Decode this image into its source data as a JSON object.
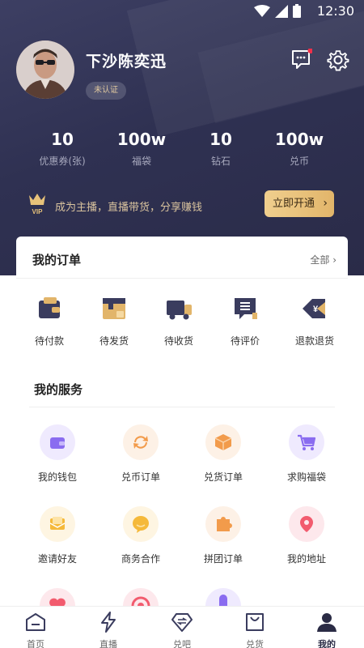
{
  "status_bar": {
    "time": "12:30"
  },
  "profile": {
    "name": "下沙陈奕迅",
    "badge": "未认证"
  },
  "stats": [
    {
      "value": "10",
      "label": "优惠券(张)"
    },
    {
      "value": "100w",
      "label": "福袋"
    },
    {
      "value": "10",
      "label": "钻石"
    },
    {
      "value": "100w",
      "label": "兑币"
    }
  ],
  "vip": {
    "text": "成为主播，直播带货，分享赚钱",
    "button": "立即开通"
  },
  "orders": {
    "title": "我的订单",
    "more": "全部",
    "items": [
      {
        "label": "待付款",
        "icon": "wallet-icon"
      },
      {
        "label": "待发货",
        "icon": "box-icon"
      },
      {
        "label": "待收货",
        "icon": "truck-icon"
      },
      {
        "label": "待评价",
        "icon": "review-icon"
      },
      {
        "label": "退款退货",
        "icon": "refund-icon"
      }
    ]
  },
  "services": {
    "title": "我的服务",
    "items": [
      {
        "label": "我的钱包",
        "icon": "wallet-icon",
        "color": "#8a6cf0"
      },
      {
        "label": "兑币订单",
        "icon": "refresh-icon",
        "color": "#f29b4b"
      },
      {
        "label": "兑货订单",
        "icon": "package-icon",
        "color": "#f29b4b"
      },
      {
        "label": "求购福袋",
        "icon": "cart-icon",
        "color": "#8a6cf0"
      },
      {
        "label": "邀请好友",
        "icon": "envelope-icon",
        "color": "#f5b93a"
      },
      {
        "label": "商务合作",
        "icon": "chat-bubble-icon",
        "color": "#f5b93a"
      },
      {
        "label": "拼团订单",
        "icon": "puzzle-icon",
        "color": "#f29b4b"
      },
      {
        "label": "我的地址",
        "icon": "location-pin-icon",
        "color": "#f25b6e"
      }
    ]
  },
  "tabbar": [
    {
      "label": "首页",
      "icon": "home-icon"
    },
    {
      "label": "直播",
      "icon": "lightning-icon"
    },
    {
      "label": "兑吧",
      "icon": "diamond-icon"
    },
    {
      "label": "兑货",
      "icon": "shopping-bag-icon"
    },
    {
      "label": "我的",
      "icon": "user-icon",
      "active": true
    }
  ],
  "colors": {
    "header_bg": "#2f3152",
    "accent_gold": "#e2b56a",
    "gold_text": "#d9c39e"
  }
}
